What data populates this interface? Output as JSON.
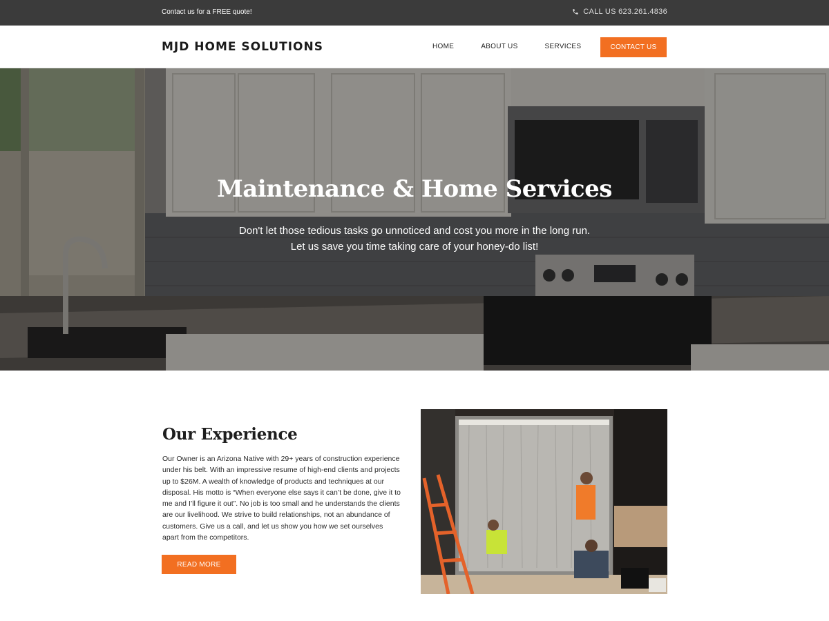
{
  "topbar": {
    "quote_text": "Contact us for a FREE quote!",
    "phone_icon": "phone-icon",
    "call_text": "CALL US 623.261.4836"
  },
  "header": {
    "logo": "MJD HOME SOLUTIONS",
    "nav": [
      "HOME",
      "ABOUT US",
      "SERVICES"
    ],
    "contact_label": "CONTACT US"
  },
  "hero": {
    "title": "Maintenance & Home Services",
    "line1": "Don't let those tedious tasks go unnoticed and cost you more in the long run.",
    "line2": "Let us save you time taking care of your honey-do list!"
  },
  "experience": {
    "title": "Our Experience",
    "body": "Our Owner is an Arizona Native with 29+ years of construction experience under his belt. With an impressive resume of high-end clients and projects up to $26M. A wealth of knowledge of products and techniques at our disposal. His motto is “When everyone else says it can’t be done, give it to me and I’ll figure it out”. No job is too small and he understands the clients are our livelihood. We strive to build relationships, not an abundance of customers. Give us a call, and let us show you how we set ourselves apart from the competitors.",
    "read_more": "READ MORE"
  },
  "colors": {
    "accent": "#f26f21",
    "topbar": "#3b3b3b"
  }
}
